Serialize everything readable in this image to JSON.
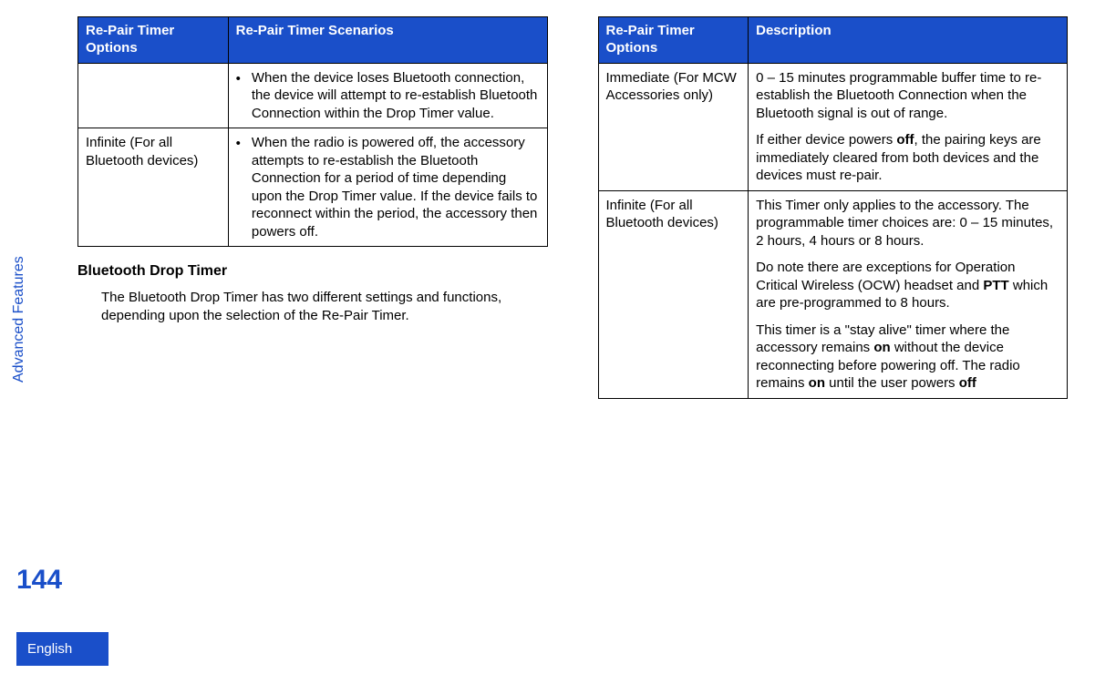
{
  "side_label": "Advanced Features",
  "page_number": "144",
  "language": "English",
  "left": {
    "table": {
      "headers": [
        "Re-Pair Timer Options",
        "Re-Pair Timer Scenarios"
      ],
      "rows": [
        {
          "option": "",
          "scenario": "When the device loses Bluetooth connection, the device will attempt to re-establish Bluetooth Connection within the Drop Timer value."
        },
        {
          "option": "Infinite (For all Bluetooth devices)",
          "scenario": "When the radio is powered off, the accessory attempts to re-establish the Bluetooth Connection for a period of time depending upon the Drop Timer value. If the device fails to reconnect within the period, the accessory then powers off."
        }
      ]
    },
    "heading": "Bluetooth Drop Timer",
    "para": "The Bluetooth Drop Timer has two different settings and functions, depending upon the selection of the Re-Pair Timer."
  },
  "right": {
    "table": {
      "headers": [
        "Re-Pair Timer Options",
        "Description"
      ],
      "rows": [
        {
          "option": "Immediate (For MCW Accessories only)",
          "p1": "0 – 15 minutes programmable buffer time to re-establish the Bluetooth Connection when the Bluetooth signal is out of range.",
          "p2a": "If either device powers ",
          "p2b": "off",
          "p2c": ", the pairing keys are immediately cleared from both devices and the devices must re-pair."
        },
        {
          "option": "Infinite (For all Bluetooth devices)",
          "p1": "This Timer only applies to the accessory. The programmable timer choices are: 0 – 15 minutes, 2 hours, 4 hours or 8 hours.",
          "p2a": "Do note there are exceptions for Operation Critical Wireless (OCW) headset and ",
          "p2b": "PTT",
          "p2c": " which are pre-programmed to 8 hours.",
          "p3a": "This timer is a \"stay alive\" timer where the accessory remains ",
          "p3b": "on",
          "p3c": " without the device reconnecting before powering off. The radio remains ",
          "p3d": "on",
          "p3e": " until the user powers ",
          "p3f": "off"
        }
      ]
    }
  }
}
